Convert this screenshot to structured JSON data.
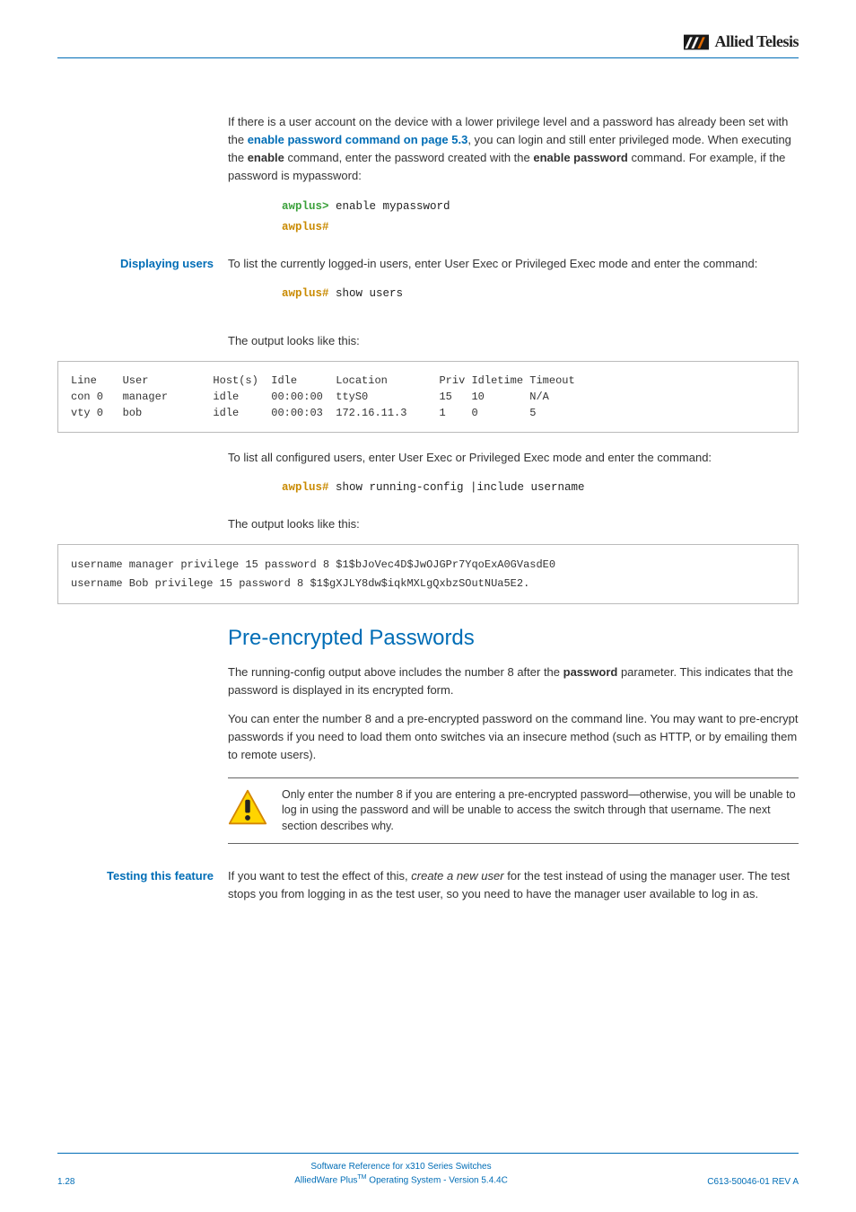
{
  "logo": {
    "brand": "Allied Telesis"
  },
  "p1_a": "If there is a user account on the device with a lower privilege level and a password has already been set with the ",
  "p1_link": "enable password command on page 5.3",
  "p1_b": ", you can login and still enter privileged mode. When executing the ",
  "p1_bold1": "enable",
  "p1_c": " command, enter the password created with the ",
  "p1_bold2": "enable password",
  "p1_d": " command. For example, if the password is mypassword:",
  "term1": {
    "prompt1": "awplus>",
    "cmd1": " enable mypassword",
    "prompt2": "awplus#"
  },
  "side_displaying": "Displaying users",
  "p2": "To list the currently logged-in users, enter User Exec or Privileged Exec mode and enter the command:",
  "term2": {
    "prompt": "awplus#",
    "cmd": " show users"
  },
  "p3": "The output looks like this:",
  "codebox1": "Line    User          Host(s)  Idle      Location        Priv Idletime Timeout\ncon 0   manager       idle     00:00:00  ttyS0           15   10       N/A\nvty 0   bob           idle     00:00:03  172.16.11.3     1    0        5",
  "p4": "To list all configured users, enter User Exec or Privileged Exec mode and enter the command:",
  "term3": {
    "prompt": "awplus#",
    "cmd": " show running-config |include username"
  },
  "p5": "The output looks like this:",
  "codebox2_l1": "username manager privilege 15 password 8 $1$bJoVec4D$JwOJGPr7YqoExA0GVasdE0",
  "codebox2_l2": "username Bob privilege 15 password 8 $1$gXJLY8dw$iqkMXLgQxbzSOutNUa5E2.",
  "h2": "Pre-encrypted Passwords",
  "p6_a": "The running-config output above includes the number 8 after the ",
  "p6_bold": "password",
  "p6_b": " parameter. This indicates that the password is displayed in its encrypted form.",
  "p7": "You can enter the number 8 and a pre-encrypted password on the command line. You may want to pre-encrypt passwords if you need to load them onto switches via an insecure method (such as HTTP, or by emailing them to remote users).",
  "caution": "Only enter the number 8 if you are entering a pre-encrypted password—otherwise, you will be unable to log in using the password and will be unable to access the switch through that username. The next section describes why.",
  "side_testing": "Testing this feature",
  "p8_a": "If you want to test the effect of this, ",
  "p8_ital": "create a new user",
  "p8_b": " for the test instead of using the manager user. The test stops you from logging in as the test user, so you need to have the manager user available to log in as.",
  "footer": {
    "left": "1.28",
    "line1": "Software Reference for x310 Series Switches",
    "line2_a": "AlliedWare Plus",
    "line2_tm": "TM",
    "line2_b": " Operating System  -  Version 5.4.4C",
    "right": "C613-50046-01 REV A"
  }
}
